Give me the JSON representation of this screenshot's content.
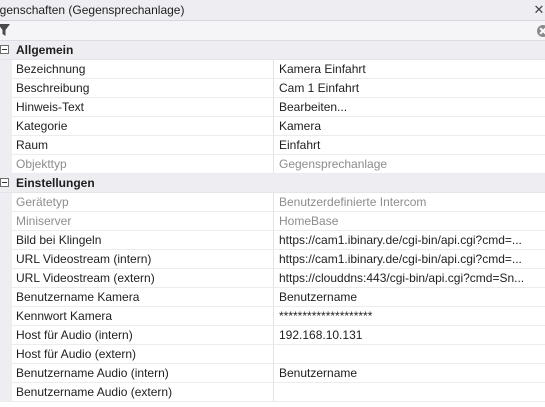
{
  "window": {
    "title": "igenschaften (Gegensprechanlage)",
    "close_glyph": "✕"
  },
  "toolbar": {
    "filter_icon": "filter-icon",
    "clear_icon": "clear-icon"
  },
  "colors": {
    "category_background": "#eeeef2",
    "disabled_text": "#8d8d8d"
  },
  "categories": [
    {
      "label": "Allgemein",
      "rows": [
        {
          "name": "Bezeichnung",
          "value": "Kamera Einfahrt",
          "disabled": false
        },
        {
          "name": "Beschreibung",
          "value": "Cam 1 Einfahrt",
          "disabled": false
        },
        {
          "name": "Hinweis-Text",
          "value": "Bearbeiten...",
          "disabled": false
        },
        {
          "name": "Kategorie",
          "value": "Kamera",
          "disabled": false
        },
        {
          "name": "Raum",
          "value": "Einfahrt",
          "disabled": false
        },
        {
          "name": "Objekttyp",
          "value": "Gegensprechanlage",
          "disabled": true
        }
      ]
    },
    {
      "label": "Einstellungen",
      "rows": [
        {
          "name": "Gerätetyp",
          "value": "Benutzerdefinierte Intercom",
          "disabled": true
        },
        {
          "name": "Miniserver",
          "value": "HomeBase",
          "disabled": true
        },
        {
          "name": "Bild bei Klingeln",
          "value": "https://cam1.ibinary.de/cgi-bin/api.cgi?cmd=...",
          "disabled": false
        },
        {
          "name": "URL Videostream (intern)",
          "value": "https://cam1.ibinary.de/cgi-bin/api.cgi?cmd=...",
          "disabled": false
        },
        {
          "name": "URL Videostream (extern)",
          "value": "https://clouddns:443/cgi-bin/api.cgi?cmd=Sn...",
          "disabled": false
        },
        {
          "name": "Benutzername Kamera",
          "value": "Benutzername",
          "disabled": false
        },
        {
          "name": "Kennwort Kamera",
          "value": "********************",
          "disabled": false
        },
        {
          "name": "Host für Audio (intern)",
          "value": "192.168.10.131",
          "disabled": false
        },
        {
          "name": "Host für Audio (extern)",
          "value": "",
          "disabled": false
        },
        {
          "name": "Benutzername Audio (intern)",
          "value": "Benutzername",
          "disabled": false
        },
        {
          "name": "Benutzername Audio (extern)",
          "value": "",
          "disabled": false
        }
      ]
    }
  ]
}
